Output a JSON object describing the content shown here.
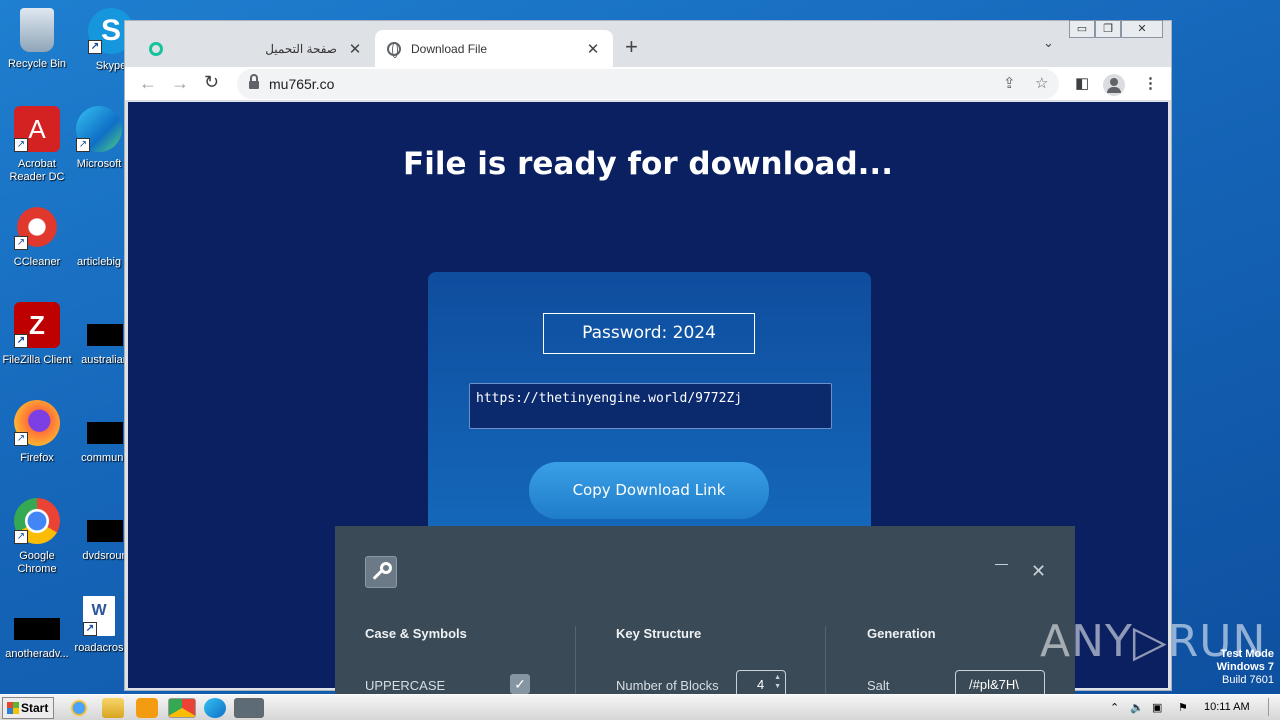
{
  "desktop": {
    "icons": [
      {
        "label": "Recycle Bin"
      },
      {
        "label": "Skype"
      },
      {
        "label": "Acrobat Reader DC"
      },
      {
        "label": "Microsoft"
      },
      {
        "label": "CCleaner"
      },
      {
        "label": "articlebig"
      },
      {
        "label": "FileZilla Client"
      },
      {
        "label": "australian"
      },
      {
        "label": "Firefox"
      },
      {
        "label": "communit"
      },
      {
        "label": "Google Chrome"
      },
      {
        "label": "dvdsroun"
      },
      {
        "label": "anotheradv..."
      },
      {
        "label": "roadacros"
      }
    ]
  },
  "browser": {
    "tabs": [
      {
        "title": "صفحة التحميل",
        "icon": "grammarly-icon"
      },
      {
        "title": "Download File",
        "icon": "globe-icon"
      }
    ],
    "new_tab": "+",
    "tab_menu": "⌄",
    "window_controls": {
      "minimize": "▭",
      "restore": "❐",
      "close": "✕"
    },
    "url": "mu765r.co"
  },
  "page": {
    "heading": "File is ready for download...",
    "password_text": "Password: 2024",
    "download_link": "https://thetinyengine.world/9772Zj",
    "copy_button": "Copy Download Link"
  },
  "dialog": {
    "columns": [
      {
        "heading": "Case & Symbols",
        "label": "UPPERCASE",
        "checked": true
      },
      {
        "heading": "Key Structure",
        "label": "Number of Blocks",
        "value": "4"
      },
      {
        "heading": "Generation",
        "label": "Salt",
        "value": "/#pl&7H\\"
      }
    ]
  },
  "watermark": {
    "anyrun": "ANY▷RUN",
    "testmode_line1": "Test Mode",
    "testmode_line2": "Windows 7",
    "testmode_line3": "Build 7601"
  },
  "taskbar": {
    "start_label": "Start",
    "clock": "10:11 AM"
  },
  "colors": {
    "page_background": "#0a2060",
    "card": "#1670c2",
    "dialog": "#3a4a56"
  }
}
